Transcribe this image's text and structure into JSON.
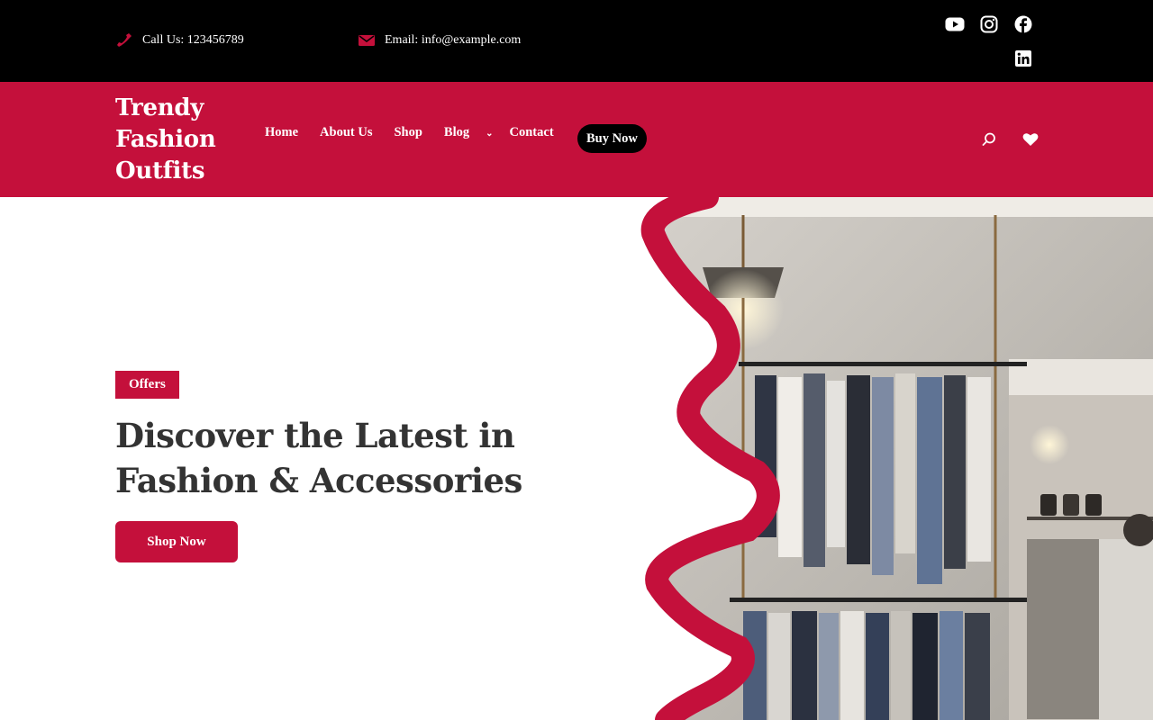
{
  "topbar": {
    "phone_text": "Call Us: 123456789",
    "email_text": "Email: info@example.com",
    "social": [
      "youtube-icon",
      "instagram-icon",
      "facebook-icon",
      "linkedin-icon"
    ]
  },
  "header": {
    "logo_lines": [
      "Trendy",
      "Fashion",
      "Outfits"
    ],
    "nav": {
      "home": "Home",
      "about": "About Us",
      "shop": "Shop",
      "blog": "Blog",
      "contact": "Contact"
    },
    "buy_now": "Buy Now",
    "icons": [
      "search-icon",
      "heart-icon"
    ]
  },
  "hero": {
    "badge": "Offers",
    "headline_line1": "Discover the Latest in",
    "headline_line2": "Fashion & Accessories",
    "cta": "Shop Now"
  },
  "colors": {
    "brand": "#c4103b",
    "topbar": "#000000",
    "text": "#333333"
  }
}
